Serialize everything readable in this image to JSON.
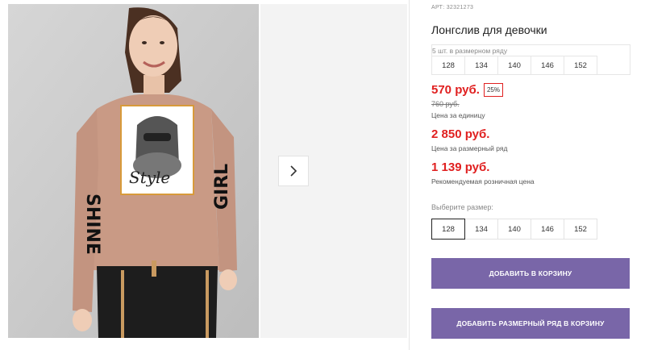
{
  "product": {
    "sku": "АРТ: 32321273",
    "title": "Лонгслив для девочки",
    "pack": {
      "label": "5 шт. в размерном ряду",
      "sizes": [
        "128",
        "134",
        "140",
        "146",
        "152"
      ]
    },
    "price": "570 руб.",
    "discount": "25%",
    "old_price": "760 руб.",
    "unit_caption": "Цена за единицу",
    "pack_price": "2 850 руб.",
    "pack_caption": "Цена за размерный ряд",
    "rrp": "1 139 руб.",
    "rrp_caption": "Рекомендуемая розничная цена"
  },
  "size_select": {
    "label": "Выберите размер:",
    "options": [
      "128",
      "134",
      "140",
      "146",
      "152"
    ],
    "selected": "128"
  },
  "actions": {
    "add_to_cart": "ДОБАВИТЬ В КОРЗИНУ",
    "add_pack_to_cart": "ДОБАВИТЬ РАЗМЕРНЫЙ РЯД В КОРЗИНУ"
  },
  "photo": {
    "print_text": "Style",
    "sleeve_left": "SHINE",
    "sleeve_right": "GIRL"
  },
  "colors": {
    "accent": "#7966a8",
    "price_red": "#e02020",
    "shirt": "#c99a85"
  },
  "icons": {
    "next": "chevron-right-icon"
  }
}
